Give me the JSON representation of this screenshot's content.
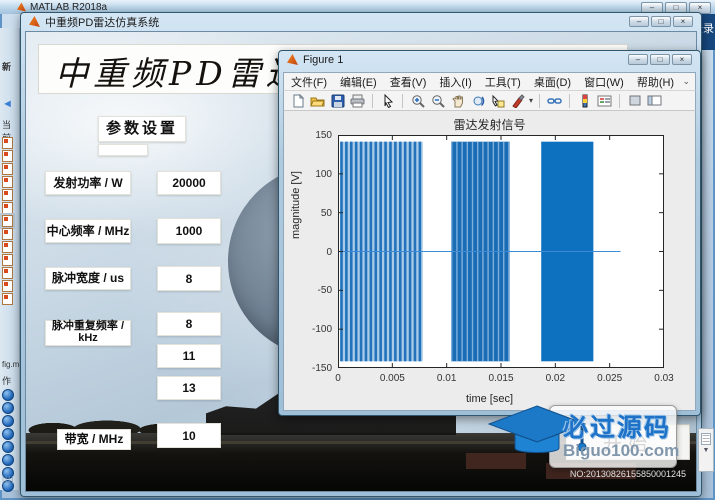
{
  "glyphs": {
    "min": "–",
    "max": "□",
    "close": "×",
    "chevron": "»",
    "back_arrow": "◄",
    "caret": "▾"
  },
  "matlab_window": {
    "title": "MATLAB R2018a",
    "login_label": "登录"
  },
  "matlab_sidebar": {
    "toolstrip_fragment": "新",
    "current_folder_label": "当前",
    "file_name_fragment": "fig.m",
    "author_fragment": "作",
    "file_tree_icon_count": 13,
    "doc_icon_count": 8
  },
  "gui_window": {
    "title": "中重频PD雷达仿真系统",
    "banner_title": "中重频PD雷达仿真系统",
    "section_header": "参数设置",
    "params": [
      {
        "label": "发射功率 / W",
        "value": "20000"
      },
      {
        "label": "中心频率 / MHz",
        "value": "1000"
      },
      {
        "label": "脉冲宽度 / us",
        "value": "8"
      },
      {
        "label": "脉冲重复频率 / kHz",
        "values": [
          "8",
          "11",
          "13"
        ]
      },
      {
        "label": "带宽 / MHz",
        "value": "10"
      }
    ],
    "start_button_label": "开始",
    "overlay_fragment": "u1"
  },
  "figure_window": {
    "title": "Figure 1",
    "menus": [
      "文件(F)",
      "编辑(E)",
      "查看(V)",
      "插入(I)",
      "工具(T)",
      "桌面(D)",
      "窗口(W)",
      "帮助(H)"
    ],
    "toolbar_icons": [
      "new-icon",
      "open-icon",
      "save-icon",
      "print-icon",
      "pointer-icon",
      "zoom-in-icon",
      "zoom-out-icon",
      "pan-icon",
      "rotate-3d-icon",
      "data-cursor-icon",
      "brush-icon",
      "link-plots-icon",
      "colorbar-icon",
      "legend-icon",
      "hide-plot-tools-icon",
      "show-plot-tools-icon"
    ]
  },
  "chart_data": {
    "type": "line",
    "title": "雷达发射信号",
    "xlabel": "time [sec]",
    "ylabel": "magnitude [V]",
    "xlim": [
      0,
      0.03
    ],
    "ylim": [
      -150,
      150
    ],
    "xticks": [
      0,
      0.005,
      0.01,
      0.015,
      0.02,
      0.025,
      0.03
    ],
    "xtick_labels": [
      "0",
      "0.005",
      "0.01",
      "0.015",
      "0.02",
      "0.025",
      "0.03"
    ],
    "yticks": [
      -150,
      -100,
      -50,
      0,
      50,
      100,
      150
    ],
    "ytick_labels": [
      "-150",
      "-100",
      "-50",
      "0",
      "50",
      "100",
      "150"
    ],
    "amplitude": 141.4,
    "baseline_end": 0.026,
    "line_color": "#3d8bd4",
    "axes_color": "#262626",
    "series": [
      {
        "name": "雷达发射信号",
        "color": "#0072bd"
      }
    ],
    "pulse_groups": [
      {
        "prf_khz": 8,
        "start": 0.0002,
        "end": 0.0078,
        "style": "striped",
        "base_fill": "#a9cbe8",
        "stripe_fill": "#2273bb",
        "stripe_width": 2.6,
        "period": 4.9
      },
      {
        "prf_khz": 11,
        "start": 0.0104,
        "end": 0.0158,
        "style": "striped",
        "base_fill": "#1a6cb4",
        "stripe_fill": "#7fb0dc",
        "stripe_width": 1.4,
        "period": 5.2
      },
      {
        "prf_khz": 13,
        "start": 0.0187,
        "end": 0.0235,
        "style": "solid",
        "fill": "#0e71bf"
      }
    ]
  },
  "watermark": {
    "line1": "必过源码",
    "line2": "Biguo100.com",
    "serial_no": "NO:20130826155850001245"
  }
}
